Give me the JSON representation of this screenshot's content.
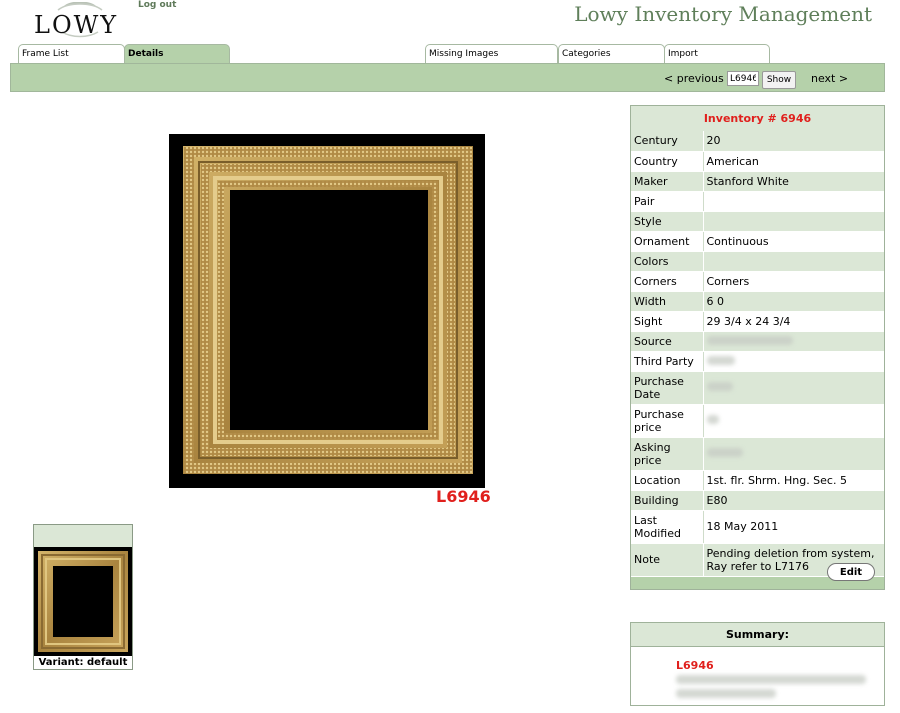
{
  "header": {
    "logo_text": "LOWY",
    "logout_label": "Log out",
    "app_title": "Lowy Inventory Management"
  },
  "tabs": [
    {
      "label": "Frame List",
      "active": false
    },
    {
      "label": "Details",
      "active": true
    },
    {
      "label": "Missing Images",
      "active": false
    },
    {
      "label": "Categories",
      "active": false
    },
    {
      "label": "Import",
      "active": false
    }
  ],
  "nav": {
    "prev_label": "< previous",
    "input_value": "L6946",
    "show_label": "Show",
    "next_label": "next >"
  },
  "image": {
    "code_label": "L6946"
  },
  "thumbnail": {
    "label": "Variant: default"
  },
  "inventory": {
    "title": "Inventory # 6946",
    "fields": [
      {
        "label": "Century",
        "value": "20"
      },
      {
        "label": "Country",
        "value": "American"
      },
      {
        "label": "Maker",
        "value": "Stanford White"
      },
      {
        "label": "Pair",
        "value": ""
      },
      {
        "label": "Style",
        "value": ""
      },
      {
        "label": "Ornament",
        "value": "Continuous"
      },
      {
        "label": "Colors",
        "value": ""
      },
      {
        "label": "Corners",
        "value": "Corners"
      },
      {
        "label": "Width",
        "value": "6 0"
      },
      {
        "label": "Sight",
        "value": "29 3/4 x 24 3/4"
      },
      {
        "label": "Source",
        "value": ""
      },
      {
        "label": "Third Party",
        "value": ""
      },
      {
        "label": "Purchase Date",
        "value": ""
      },
      {
        "label": "Purchase price",
        "value": ""
      },
      {
        "label": "Asking price",
        "value": ""
      },
      {
        "label": "Location",
        "value": "1st. flr. Shrm. Hng. Sec. 5"
      },
      {
        "label": "Building",
        "value": "E80"
      },
      {
        "label": "Last Modified",
        "value": "18 May 2011"
      },
      {
        "label": "Note",
        "value": "Pending deletion from system, Ray refer to L7176"
      }
    ],
    "edit_label": "Edit"
  },
  "summary": {
    "title": "Summary:",
    "code": "L6946"
  },
  "colors": {
    "accent_green": "#b5d1aa",
    "light_green": "#dbe7d6",
    "title_green": "#5f7f5a",
    "highlight_red": "#e0201d"
  }
}
